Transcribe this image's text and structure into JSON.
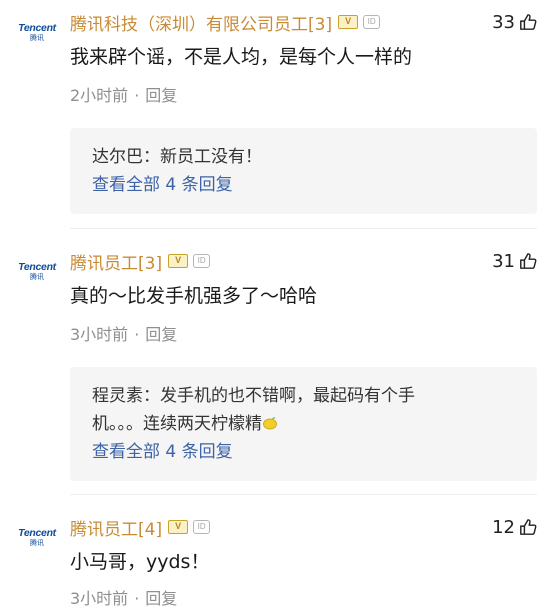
{
  "comments": [
    {
      "avatar_en": "Tencent",
      "avatar_cn": "腾讯",
      "username": "腾讯科技（深圳）有限公司员工[3]",
      "badge_v": "V",
      "badge_id": "ID",
      "likes": "33",
      "text": "我来辟个谣，不是人均，是每个人一样的",
      "time": "2小时前",
      "reply_label": "回复",
      "reply": {
        "author": "达尔巴：",
        "text": "新员工没有！",
        "text_line2": "",
        "view_all": "查看全部 4 条回复"
      }
    },
    {
      "avatar_en": "Tencent",
      "avatar_cn": "腾讯",
      "username": "腾讯员工[3]",
      "badge_v": "V",
      "badge_id": "ID",
      "likes": "31",
      "text": "真的～比发手机强多了～哈哈",
      "time": "3小时前",
      "reply_label": "回复",
      "reply": {
        "author": "程灵素：",
        "text": "发手机的也不错啊，最起码有个手",
        "text_line2": "机。。。连续两天柠檬精",
        "view_all": "查看全部 4 条回复"
      }
    },
    {
      "avatar_en": "Tencent",
      "avatar_cn": "腾讯",
      "username": "腾讯员工[4]",
      "badge_v": "V",
      "badge_id": "ID",
      "likes": "12",
      "text": "小马哥，yyds！",
      "time": "3小时前",
      "reply_label": "回复"
    }
  ],
  "meta_separator": "·",
  "icons": {
    "like": "thumbs-up-icon",
    "lemon": "lemon-emoji-icon"
  },
  "colors": {
    "username": "#c98b35",
    "link": "#3d63a6",
    "meta": "#8f8f8f",
    "reply_bg": "#f5f5f5"
  }
}
